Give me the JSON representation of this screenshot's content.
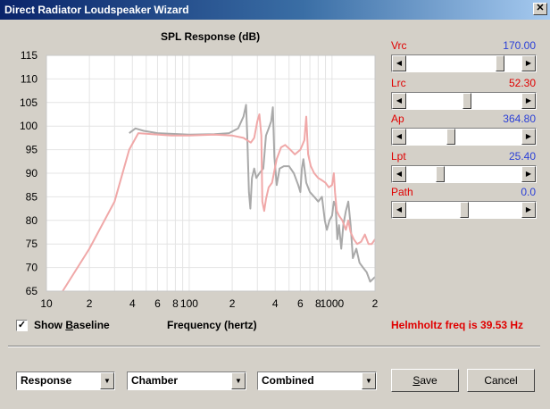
{
  "window": {
    "title": "Direct Radiator Loudspeaker Wizard",
    "close_glyph": "✕"
  },
  "chart": {
    "title": "SPL Response (dB)",
    "xlabel": "Frequency (hertz)"
  },
  "chart_data": {
    "type": "line",
    "title": "SPL Response (dB)",
    "xlabel": "Frequency (hertz)",
    "ylabel": "",
    "xscale": "log",
    "xlim": [
      10,
      2000
    ],
    "ylim": [
      65,
      115
    ],
    "yticks": [
      65,
      70,
      75,
      80,
      85,
      90,
      95,
      100,
      105,
      110,
      115
    ],
    "xtick_labels": [
      {
        "x": 10,
        "label": "10"
      },
      {
        "x": 20,
        "label": "2"
      },
      {
        "x": 40,
        "label": "4"
      },
      {
        "x": 60,
        "label": "6"
      },
      {
        "x": 80,
        "label": "8"
      },
      {
        "x": 100,
        "label": "100"
      },
      {
        "x": 200,
        "label": "2"
      },
      {
        "x": 400,
        "label": "4"
      },
      {
        "x": 600,
        "label": "6"
      },
      {
        "x": 800,
        "label": "8"
      },
      {
        "x": 1000,
        "label": "1000"
      },
      {
        "x": 2000,
        "label": "2"
      }
    ],
    "grid": true,
    "series": [
      {
        "color": "#a9a9a9",
        "points": [
          [
            38,
            98.5
          ],
          [
            42,
            99.5
          ],
          [
            48,
            99
          ],
          [
            60,
            98.5
          ],
          [
            100,
            98.2
          ],
          [
            150,
            98.3
          ],
          [
            190,
            98.5
          ],
          [
            220,
            99.5
          ],
          [
            240,
            102
          ],
          [
            250,
            104.5
          ],
          [
            255,
            98
          ],
          [
            262,
            86
          ],
          [
            268,
            82.5
          ],
          [
            275,
            89
          ],
          [
            285,
            91
          ],
          [
            295,
            89
          ],
          [
            310,
            90
          ],
          [
            330,
            91
          ],
          [
            345,
            98
          ],
          [
            360,
            99.5
          ],
          [
            375,
            101
          ],
          [
            385,
            104
          ],
          [
            395,
            93.5
          ],
          [
            410,
            87.5
          ],
          [
            430,
            91
          ],
          [
            460,
            91.5
          ],
          [
            500,
            91.5
          ],
          [
            540,
            90
          ],
          [
            580,
            87.5
          ],
          [
            600,
            86
          ],
          [
            615,
            91
          ],
          [
            630,
            93
          ],
          [
            660,
            88
          ],
          [
            700,
            86
          ],
          [
            750,
            85
          ],
          [
            800,
            84
          ],
          [
            850,
            85
          ],
          [
            890,
            80
          ],
          [
            920,
            78
          ],
          [
            960,
            80
          ],
          [
            1000,
            81
          ],
          [
            1030,
            84
          ],
          [
            1060,
            83
          ],
          [
            1090,
            76
          ],
          [
            1120,
            79
          ],
          [
            1160,
            74
          ],
          [
            1200,
            79
          ],
          [
            1250,
            82
          ],
          [
            1300,
            84
          ],
          [
            1350,
            79
          ],
          [
            1400,
            72
          ],
          [
            1480,
            74
          ],
          [
            1560,
            71
          ],
          [
            1650,
            70
          ],
          [
            1750,
            69
          ],
          [
            1850,
            67
          ],
          [
            2000,
            68
          ]
        ]
      },
      {
        "color": "#f0a8a8",
        "points": [
          [
            13,
            65
          ],
          [
            20,
            74
          ],
          [
            30,
            84
          ],
          [
            38,
            95
          ],
          [
            44,
            98.5
          ],
          [
            55,
            98.3
          ],
          [
            75,
            98
          ],
          [
            100,
            98
          ],
          [
            150,
            98.2
          ],
          [
            200,
            98
          ],
          [
            240,
            97.5
          ],
          [
            270,
            96.5
          ],
          [
            285,
            97.5
          ],
          [
            300,
            101
          ],
          [
            310,
            102.5
          ],
          [
            320,
            98
          ],
          [
            325,
            84
          ],
          [
            335,
            82
          ],
          [
            345,
            84.5
          ],
          [
            360,
            87
          ],
          [
            380,
            88
          ],
          [
            410,
            93
          ],
          [
            440,
            95.5
          ],
          [
            470,
            96
          ],
          [
            510,
            95
          ],
          [
            550,
            94
          ],
          [
            600,
            95
          ],
          [
            640,
            97
          ],
          [
            660,
            102
          ],
          [
            680,
            94
          ],
          [
            710,
            91.5
          ],
          [
            750,
            90
          ],
          [
            800,
            89
          ],
          [
            850,
            88.5
          ],
          [
            900,
            88
          ],
          [
            950,
            87
          ],
          [
            1000,
            87.5
          ],
          [
            1030,
            90
          ],
          [
            1050,
            86
          ],
          [
            1080,
            82
          ],
          [
            1120,
            81
          ],
          [
            1180,
            80
          ],
          [
            1250,
            78
          ],
          [
            1300,
            80
          ],
          [
            1350,
            77.5
          ],
          [
            1420,
            76
          ],
          [
            1500,
            75
          ],
          [
            1600,
            75.5
          ],
          [
            1700,
            77
          ],
          [
            1800,
            75
          ],
          [
            1900,
            75
          ],
          [
            2000,
            76
          ]
        ]
      }
    ]
  },
  "sliders": [
    {
      "label": "Vrc",
      "value": "170.00",
      "value_color": "blue",
      "fraction": 0.84
    },
    {
      "label": "Lrc",
      "value": "52.30",
      "value_color": "red",
      "fraction": 0.53
    },
    {
      "label": "Ap",
      "value": "364.80",
      "value_color": "blue",
      "fraction": 0.38
    },
    {
      "label": "Lpt",
      "value": "25.40",
      "value_color": "blue",
      "fraction": 0.28
    },
    {
      "label": "Path",
      "value": "0.0",
      "value_color": "blue",
      "fraction": 0.5
    }
  ],
  "baseline": {
    "label_pre": "Show ",
    "label_accel": "B",
    "label_post": "aseline",
    "checked": true,
    "check_glyph": "✓"
  },
  "helmholtz_text": "Helmholtz freq is 39.53 Hz",
  "dropdowns": [
    {
      "value": "Response"
    },
    {
      "value": "Chamber"
    },
    {
      "value": "Combined"
    }
  ],
  "buttons": {
    "save_accel": "S",
    "save_rest": "ave",
    "cancel": "Cancel"
  },
  "glyphs": {
    "left": "◀",
    "right": "▶",
    "down": "▼"
  }
}
